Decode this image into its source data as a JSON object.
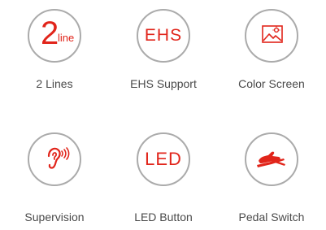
{
  "accent_color": "#e1251b",
  "border_color": "#ababab",
  "features": [
    {
      "label": "2 Lines",
      "icon": "two-lines-icon",
      "icon_big_text": "2",
      "icon_small_text": "line"
    },
    {
      "label": "EHS Support",
      "icon": "ehs-icon",
      "icon_text": "EHS"
    },
    {
      "label": "Color Screen",
      "icon": "picture-icon"
    },
    {
      "label": "Supervision",
      "icon": "ear-icon"
    },
    {
      "label": "LED Button",
      "icon": "led-icon",
      "icon_text": "LED"
    },
    {
      "label": "Pedal Switch",
      "icon": "pedal-icon"
    }
  ]
}
